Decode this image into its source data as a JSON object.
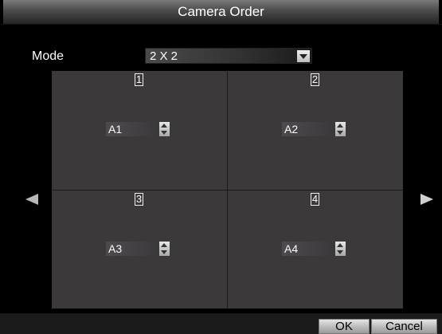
{
  "window": {
    "title": "Camera Order"
  },
  "mode": {
    "label": "Mode",
    "selected": "2 X 2"
  },
  "cells": [
    {
      "number": "1",
      "camera": "A1"
    },
    {
      "number": "2",
      "camera": "A2"
    },
    {
      "number": "3",
      "camera": "A3"
    },
    {
      "number": "4",
      "camera": "A4"
    }
  ],
  "buttons": {
    "ok": "OK",
    "cancel": "Cancel"
  },
  "icons": {
    "prev": "left-arrow-icon",
    "next": "right-arrow-icon",
    "dropdown": "chevron-down-icon",
    "spin_up": "arrow-up-icon",
    "spin_down": "arrow-down-icon"
  },
  "colors": {
    "background": "#000000",
    "grid": "#3c393b",
    "text": "#ffffff"
  }
}
